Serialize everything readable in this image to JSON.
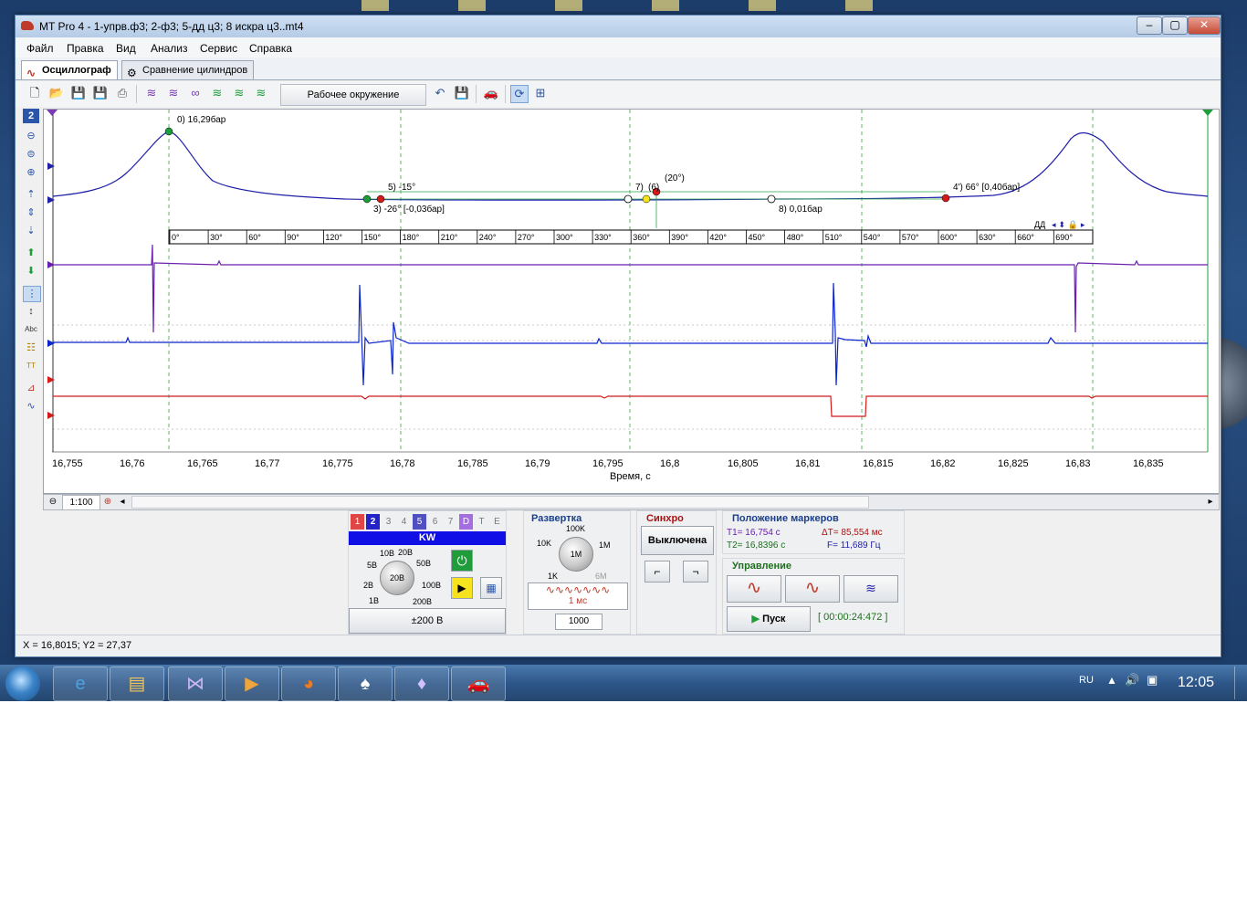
{
  "window": {
    "title": "MT Pro 4 - 1-упрв.ф3; 2-ф3; 5-дд ц3; 8 искра ц3..mt4",
    "controls": {
      "minimize": "–",
      "maximize": "▢",
      "close": "✕"
    }
  },
  "menu": [
    "Файл",
    "Правка",
    "Вид",
    "Анализ",
    "Сервис",
    "Справка"
  ],
  "tabs": [
    {
      "label": "Осциллограф",
      "active": true,
      "icon": "waveform-icon"
    },
    {
      "label": "Сравнение цилиндров",
      "active": false,
      "icon": "gear-icon"
    }
  ],
  "toolbar": {
    "workspace": "Рабочее окружение",
    "selected_channel": "2"
  },
  "scope": {
    "x_label": "Время, с",
    "x_ticks": [
      "16,755",
      "16,76",
      "16,765",
      "16,77",
      "16,775",
      "16,78",
      "16,785",
      "16,79",
      "16,795",
      "16,8",
      "16,805",
      "16,81",
      "16,815",
      "16,82",
      "16,825",
      "16,83",
      "16,835"
    ],
    "degree_ticks": [
      "0°",
      "30°",
      "60°",
      "90°",
      "120°",
      "150°",
      "180°",
      "210°",
      "240°",
      "270°",
      "300°",
      "330°",
      "360°",
      "390°",
      "420°",
      "450°",
      "480°",
      "510°",
      "540°",
      "570°",
      "600°",
      "630°",
      "660°",
      "690°"
    ],
    "degree_scale_label": "ДД",
    "annotations": {
      "a0": "0)  16,29бар",
      "a5": "5)  -15°",
      "a3": "3)  -26° [-0,03бар]",
      "a7": "7)",
      "a6": "(6)",
      "a20": "(20°)",
      "a4": "4')  66° [0,40бар]",
      "a8": "8)  0,01бар"
    },
    "colors": {
      "ch1": "#6a1fb0",
      "ch2": "#1f1fa8",
      "ch5": "#0b25cc",
      "ch8": "#d21b1b",
      "grid": "#2ea84b"
    }
  },
  "zoom": {
    "value": "1:100"
  },
  "channels": {
    "tabs": [
      "1",
      "2",
      "3",
      "4",
      "5",
      "6",
      "7",
      "D",
      "T",
      "E"
    ],
    "active": "2",
    "name": "KW",
    "knob_labels": [
      "10В",
      "20В",
      "5В",
      "50В",
      "2В",
      "100В",
      "1В",
      "200В"
    ],
    "knob_value": "20В",
    "range": "±200 В"
  },
  "sweep": {
    "title": "Развертка",
    "knob_labels": [
      "100K",
      "10K",
      "1M",
      "1K",
      "6M"
    ],
    "knob_value": "1M",
    "time": "1 мс",
    "samples": "1000"
  },
  "sync": {
    "title": "Синхро",
    "mode": "Выключена"
  },
  "markers": {
    "title": "Положение маркеров",
    "t1": "T1= 16,754 с",
    "t2": "T2= 16,8396 с",
    "dt": "ΔT= 85,554 мс",
    "f": "F= 11,689 Гц"
  },
  "control": {
    "title": "Управление",
    "start": "Пуск",
    "timer": "[ 00:00:24:472 ]"
  },
  "status": "X = 16,8015; Y2 = 27,37",
  "taskbar": {
    "lang": "RU",
    "time": "12:05"
  }
}
